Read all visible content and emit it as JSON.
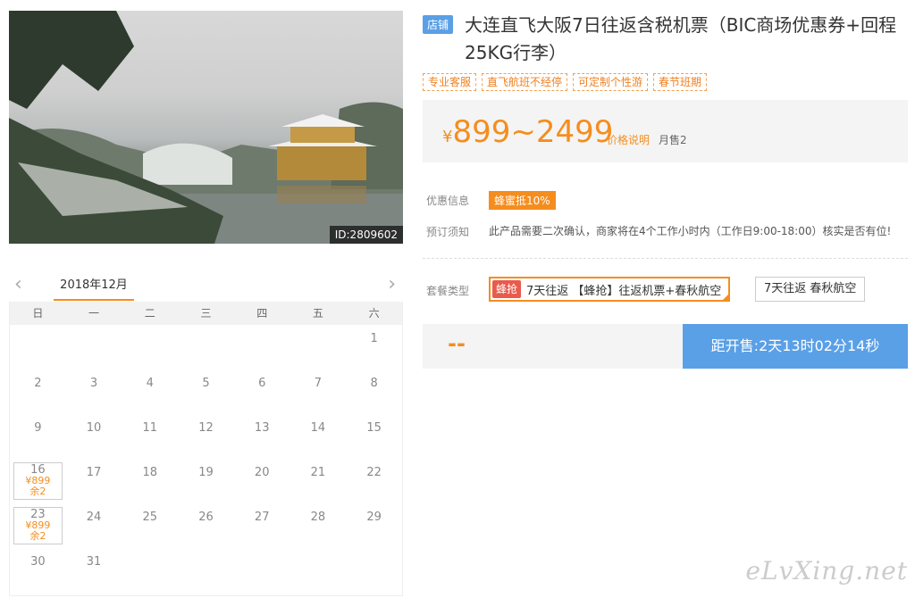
{
  "photo": {
    "id_label": "ID:2809602"
  },
  "product": {
    "shop_tag": "店铺",
    "title": "大连直飞大阪7日往返含税机票（BIC商场优惠券+回程25KG行李）",
    "features": [
      "专业客服",
      "直飞航班不经停",
      "可定制个性游",
      "春节班期"
    ],
    "price_currency": "¥",
    "price_range": "899~2499",
    "price_note": "价格说明",
    "monthly_sold": "月售2"
  },
  "info": {
    "promo_label": "优惠信息",
    "promo_badge": "蜂蜜抵10%",
    "notice_label": "预订须知",
    "notice_text": "此产品需要二次确认，商家将在4个工作小时内（工作日9:00-18:00）核实是否有位!",
    "package_label": "套餐类型",
    "package1_badge": "蜂抢",
    "package1_text": "7天往返 【蜂抢】往返机票+春秋航空",
    "package2_text": "7天往返 春秋航空"
  },
  "buy": {
    "price_placeholder": "--",
    "countdown": "距开售:2天13时02分14秒"
  },
  "calendar": {
    "prev": "‹",
    "next": "›",
    "month": "2018年12月",
    "weekdays": [
      "日",
      "一",
      "二",
      "三",
      "四",
      "五",
      "六"
    ],
    "days": [
      {
        "d": ""
      },
      {
        "d": ""
      },
      {
        "d": ""
      },
      {
        "d": ""
      },
      {
        "d": ""
      },
      {
        "d": ""
      },
      {
        "d": "1"
      },
      {
        "d": "2"
      },
      {
        "d": "3"
      },
      {
        "d": "4"
      },
      {
        "d": "5"
      },
      {
        "d": "6"
      },
      {
        "d": "7"
      },
      {
        "d": "8"
      },
      {
        "d": "9"
      },
      {
        "d": "10"
      },
      {
        "d": "11"
      },
      {
        "d": "12"
      },
      {
        "d": "13"
      },
      {
        "d": "14"
      },
      {
        "d": "15"
      },
      {
        "d": "16",
        "price": "¥899",
        "stock": "余2"
      },
      {
        "d": "17"
      },
      {
        "d": "18"
      },
      {
        "d": "19"
      },
      {
        "d": "20"
      },
      {
        "d": "21"
      },
      {
        "d": "22"
      },
      {
        "d": "23",
        "price": "¥899",
        "stock": "余2"
      },
      {
        "d": "24"
      },
      {
        "d": "25"
      },
      {
        "d": "26"
      },
      {
        "d": "27"
      },
      {
        "d": "28"
      },
      {
        "d": "29"
      },
      {
        "d": "30"
      },
      {
        "d": "31"
      }
    ]
  },
  "watermark": "eLvXing.net"
}
